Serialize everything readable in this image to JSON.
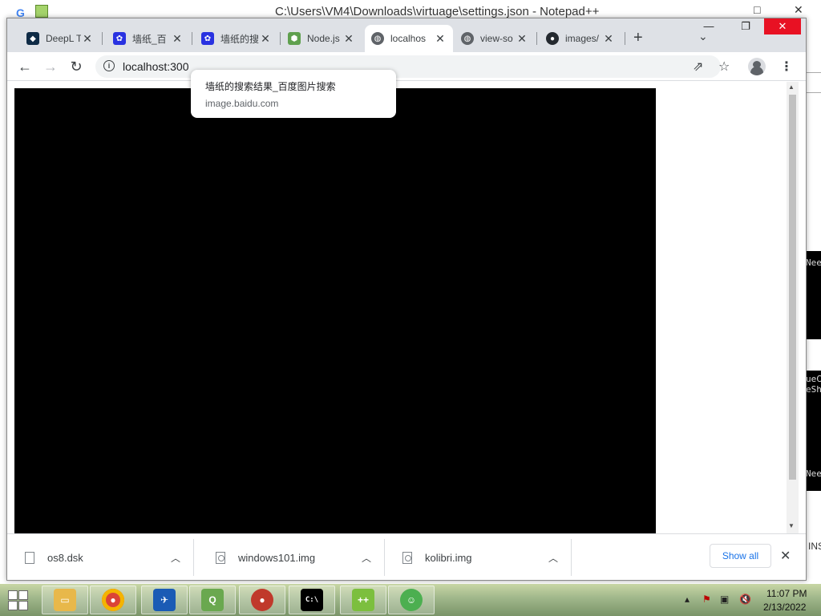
{
  "background_window": {
    "title": "C:\\Users\\VM4\\Downloads\\virtuage\\settings.json - Notepad++",
    "right_fragments": [
      "Nee",
      "ueC",
      "eSh",
      "Nee"
    ],
    "status_ins": "INS"
  },
  "browser": {
    "tabs": [
      {
        "label": "DeepL T",
        "icon": "deepl-icon",
        "color": "#0f2b46"
      },
      {
        "label": "墙纸_百",
        "icon": "baidu-paw-icon",
        "color": "#2932e1"
      },
      {
        "label": "墙纸的搜",
        "icon": "baidu-paw-icon",
        "color": "#2932e1"
      },
      {
        "label": "Node.js",
        "icon": "nodejs-icon",
        "color": "#5fa04e"
      },
      {
        "label": "localhos",
        "icon": "globe-icon",
        "color": "#5f6368",
        "active": true
      },
      {
        "label": "view-so",
        "icon": "globe-icon",
        "color": "#5f6368"
      },
      {
        "label": "images/",
        "icon": "github-icon",
        "color": "#24292f"
      }
    ],
    "new_tab": "+",
    "address": "localhost:300",
    "tooltip": {
      "title": "墙纸的搜索结果_百度图片搜索",
      "url": "image.baidu.com"
    }
  },
  "downloads": {
    "items": [
      {
        "name": "os8.dsk",
        "icon": "file-icon"
      },
      {
        "name": "windows101.img",
        "icon": "image-file-icon"
      },
      {
        "name": "kolibri.img",
        "icon": "image-file-icon"
      }
    ],
    "show_all": "Show all"
  },
  "taskbar": {
    "apps": [
      {
        "name": "file-explorer-icon",
        "color": "#e8b84a"
      },
      {
        "name": "chrome-icon",
        "color": "#4285f4"
      },
      {
        "name": "fenix-icon",
        "color": "#1a5bb5"
      },
      {
        "name": "qgis-icon",
        "color": "#6aa84f"
      },
      {
        "name": "pcem-icon",
        "color": "#c0392b"
      },
      {
        "name": "cmd-icon",
        "color": "#000000"
      },
      {
        "name": "notepad-plus-plus-icon",
        "color": "#7cbf3e"
      },
      {
        "name": "frog-app-icon",
        "color": "#4caf50"
      }
    ],
    "time": "11:07 PM",
    "date": "2/13/2022"
  }
}
